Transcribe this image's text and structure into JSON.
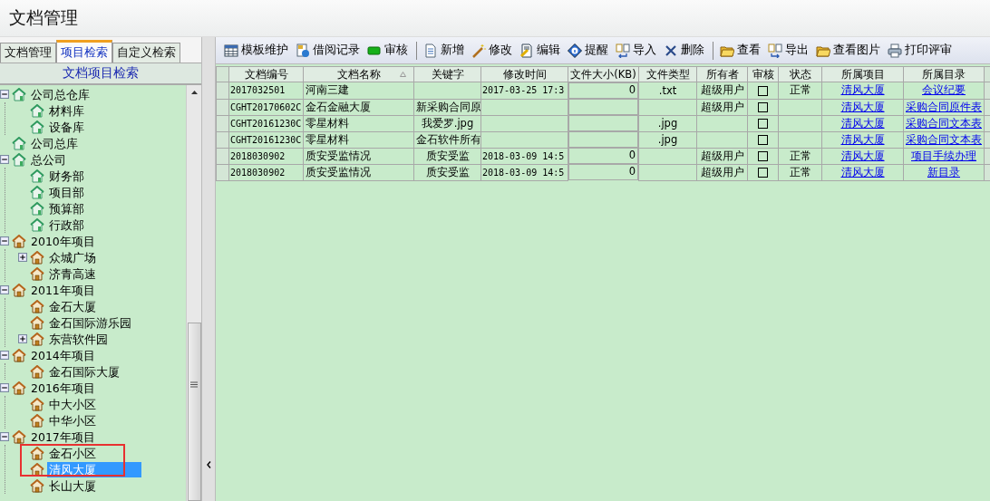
{
  "window": {
    "title": "文档管理"
  },
  "tabs": [
    {
      "label": "文档管理",
      "selected": false
    },
    {
      "label": "项目检索",
      "selected": true
    },
    {
      "label": "自定义检索",
      "selected": false
    }
  ],
  "tree": {
    "title": "文档项目检索",
    "items": [
      {
        "label": "公司总仓库",
        "kind": "office",
        "selected": false,
        "expanded": true,
        "children": [
          {
            "label": "材料库",
            "kind": "office",
            "selected": false
          },
          {
            "label": "设备库",
            "kind": "office",
            "selected": false
          }
        ]
      },
      {
        "label": "公司总库",
        "kind": "office",
        "selected": false
      },
      {
        "label": "总公司",
        "kind": "office",
        "selected": false,
        "expanded": true,
        "children": [
          {
            "label": "财务部",
            "kind": "office",
            "selected": false
          },
          {
            "label": "项目部",
            "kind": "office",
            "selected": false
          },
          {
            "label": "预算部",
            "kind": "office",
            "selected": false
          },
          {
            "label": "行政部",
            "kind": "office",
            "selected": false
          }
        ]
      },
      {
        "label": "2010年项目",
        "kind": "project",
        "selected": false,
        "expanded": true,
        "children": [
          {
            "label": "众城广场",
            "kind": "project",
            "selected": false,
            "expanded": false
          },
          {
            "label": "济青高速",
            "kind": "project",
            "selected": false
          }
        ]
      },
      {
        "label": "2011年项目",
        "kind": "project",
        "selected": false,
        "expanded": true,
        "children": [
          {
            "label": "金石大厦",
            "kind": "project",
            "selected": false
          },
          {
            "label": "金石国际游乐园",
            "kind": "project",
            "selected": false
          },
          {
            "label": "东营软件园",
            "kind": "project",
            "selected": false,
            "expanded": false
          }
        ]
      },
      {
        "label": "2014年项目",
        "kind": "project",
        "selected": false,
        "expanded": true,
        "children": [
          {
            "label": "金石国际大厦",
            "kind": "project",
            "selected": false
          }
        ]
      },
      {
        "label": "2016年项目",
        "kind": "project",
        "selected": false,
        "expanded": true,
        "children": [
          {
            "label": "中大小区",
            "kind": "project",
            "selected": false
          },
          {
            "label": "中华小区",
            "kind": "project",
            "selected": false
          }
        ]
      },
      {
        "label": "2017年项目",
        "kind": "project",
        "selected": false,
        "expanded": true,
        "children": [
          {
            "label": "金石小区",
            "kind": "project",
            "selected": false
          },
          {
            "label": "清风大厦",
            "kind": "project",
            "selected": true
          },
          {
            "label": "长山大厦",
            "kind": "project",
            "selected": false
          }
        ]
      }
    ]
  },
  "toolbar": [
    [
      "模板维护",
      "借阅记录",
      "审核"
    ],
    [
      "新增",
      "修改",
      "编辑",
      "提醒",
      "导入",
      "删除"
    ],
    [
      "查看",
      "导出",
      "查看图片",
      "打印评审"
    ]
  ],
  "table": {
    "columns": [
      "文档编号",
      "文档名称",
      "关键字",
      "修改时间",
      "文件大小(KB)",
      "文件类型",
      "所有者",
      "审核",
      "状态",
      "所属项目",
      "所属目录"
    ],
    "rows": [
      {
        "number": "2017032501",
        "name": "河南三建",
        "keyword": "",
        "modified": "2017-03-25 17:3",
        "size": "0",
        "type": ".txt",
        "owner": "超级用户",
        "reviewed": false,
        "status": "正常",
        "project": "清风大厦",
        "folder": "会议纪要"
      },
      {
        "number": "CGHT20170602C",
        "name": "金石金融大厦",
        "keyword": "新采购合同原",
        "modified": "",
        "size": "",
        "type": "",
        "owner": "超级用户",
        "reviewed": false,
        "status": "",
        "project": "清风大厦",
        "folder": "采购合同原件表"
      },
      {
        "number": "CGHT20161230C",
        "name": "零星材料",
        "keyword": "我爱罗.jpg",
        "modified": "",
        "size": "",
        "type": ".jpg",
        "owner": "",
        "reviewed": false,
        "status": "",
        "project": "清风大厦",
        "folder": "采购合同文本表"
      },
      {
        "number": "CGHT20161230C",
        "name": "零星材料",
        "keyword": "金石软件所有",
        "modified": "",
        "size": "",
        "type": ".jpg",
        "owner": "",
        "reviewed": false,
        "status": "",
        "project": "清风大厦",
        "folder": "采购合同文本表"
      },
      {
        "number": "2018030902",
        "name": "质安受监情况",
        "keyword": "质安受监",
        "modified": "2018-03-09 14:5",
        "size": "0",
        "type": "",
        "owner": "超级用户",
        "reviewed": false,
        "status": "正常",
        "project": "清风大厦",
        "folder": "项目手续办理"
      },
      {
        "number": "2018030902",
        "name": "质安受监情况",
        "keyword": "质安受监",
        "modified": "2018-03-09 14:5",
        "size": "0",
        "type": "",
        "owner": "超级用户",
        "reviewed": false,
        "status": "正常",
        "project": "清风大厦",
        "folder": "新目录"
      }
    ]
  }
}
